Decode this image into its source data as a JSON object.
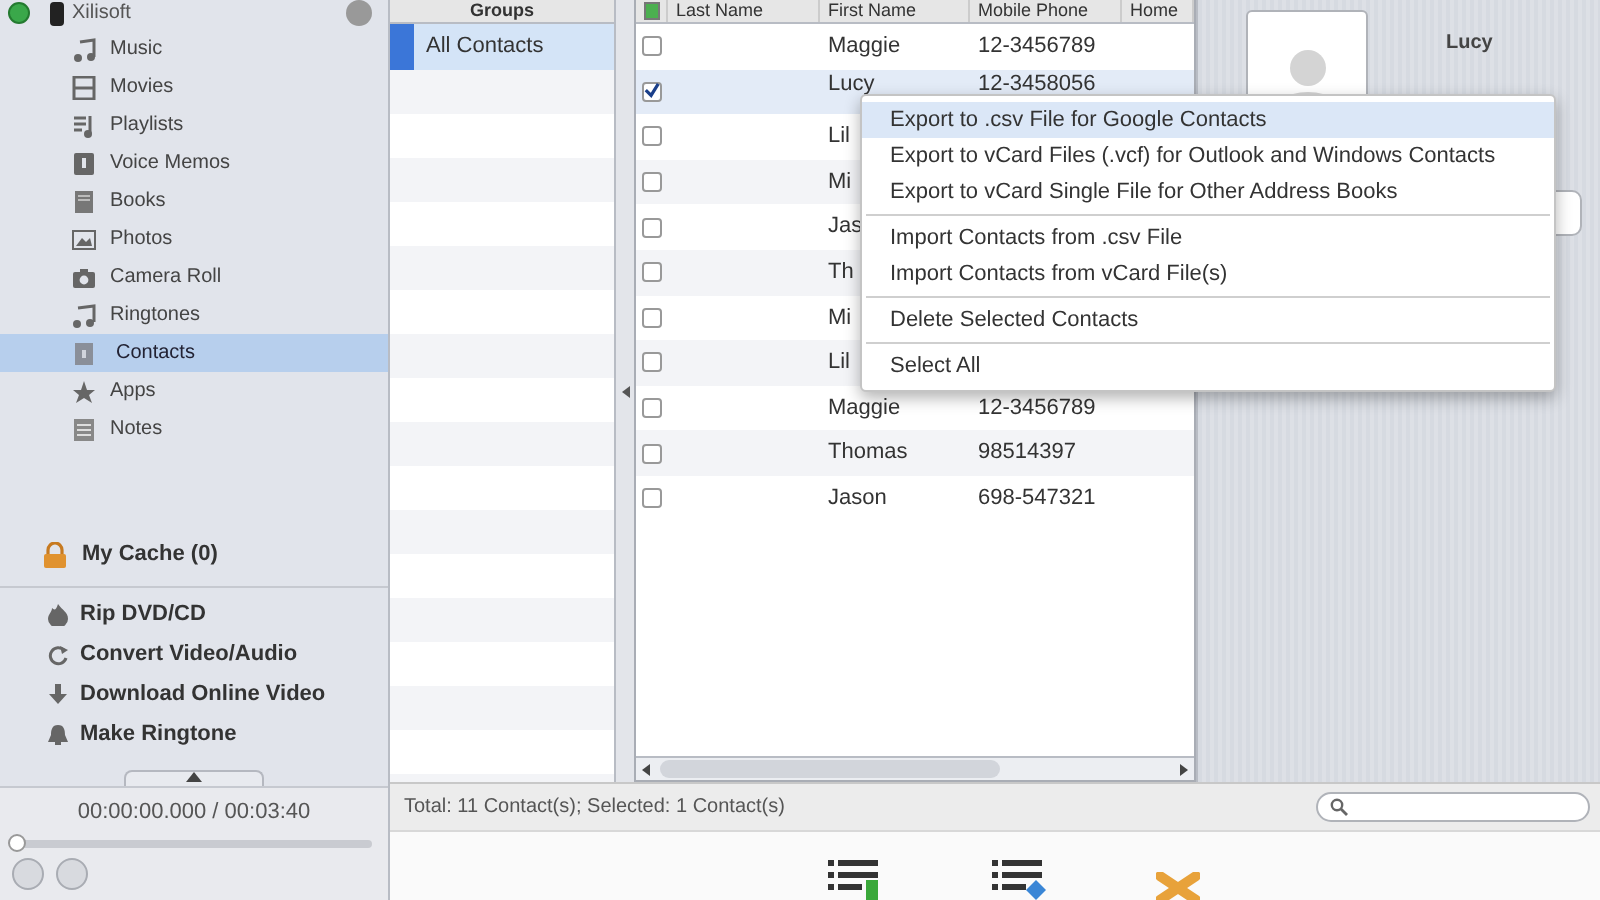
{
  "device": {
    "name": "Xilisoft"
  },
  "library": [
    {
      "label": "Music",
      "selected": false
    },
    {
      "label": "Movies",
      "selected": false
    },
    {
      "label": "Playlists",
      "selected": false
    },
    {
      "label": "Voice Memos",
      "selected": false
    },
    {
      "label": "Books",
      "selected": false
    },
    {
      "label": "Photos",
      "selected": false
    },
    {
      "label": "Camera Roll",
      "selected": false
    },
    {
      "label": "Ringtones",
      "selected": false
    },
    {
      "label": "Contacts",
      "selected": true
    },
    {
      "label": "Apps",
      "selected": false
    },
    {
      "label": "Notes",
      "selected": false
    }
  ],
  "cache": {
    "label": "My Cache (0)"
  },
  "tools": [
    "Rip DVD/CD",
    "Convert Video/Audio",
    "Download Online Video",
    "Make Ringtone"
  ],
  "player": {
    "time": "00:00:00.000 / 00:03:40",
    "level": 0
  },
  "groups": {
    "header": "Groups",
    "items": [
      {
        "label": "All Contacts",
        "selected": true
      }
    ]
  },
  "table": {
    "select_all_checked": true,
    "columns": [
      "Last Name",
      "First Name",
      "Mobile Phone",
      "Home"
    ],
    "rows": [
      {
        "checked": false,
        "first_name": "Maggie",
        "mobile": "12-3456789"
      },
      {
        "checked": true,
        "first_name": "Lucy",
        "mobile": "12-3458056"
      },
      {
        "checked": false,
        "first_name": "Lil"
      },
      {
        "checked": false,
        "first_name": "Mi"
      },
      {
        "checked": false,
        "first_name": "Jas"
      },
      {
        "checked": false,
        "first_name": "Th"
      },
      {
        "checked": false,
        "first_name": "Mi"
      },
      {
        "checked": false,
        "first_name": "Lil"
      },
      {
        "checked": false,
        "first_name": "Maggie",
        "mobile": "12-3456789"
      },
      {
        "checked": false,
        "first_name": "Thomas",
        "mobile": "98514397"
      },
      {
        "checked": false,
        "first_name": "Jason",
        "mobile": "698-547321"
      }
    ]
  },
  "context_menu": [
    [
      {
        "label": "Export to .csv File for Google Contacts",
        "selected": true
      },
      {
        "label": "Export to vCard Files (.vcf) for Outlook and Windows Contacts",
        "selected": false
      },
      {
        "label": "Export to vCard Single File for Other Address Books",
        "selected": false
      }
    ],
    [
      {
        "label": "Import Contacts from .csv File",
        "selected": false
      },
      {
        "label": "Import Contacts from vCard File(s)",
        "selected": false
      }
    ],
    [
      {
        "label": "Delete Selected Contacts",
        "selected": false
      }
    ],
    [
      {
        "label": "Select All",
        "selected": false
      }
    ]
  ],
  "detail": {
    "name": "Lucy"
  },
  "status_bar": "Total: 11 Contact(s); Selected: 1 Contact(s)"
}
